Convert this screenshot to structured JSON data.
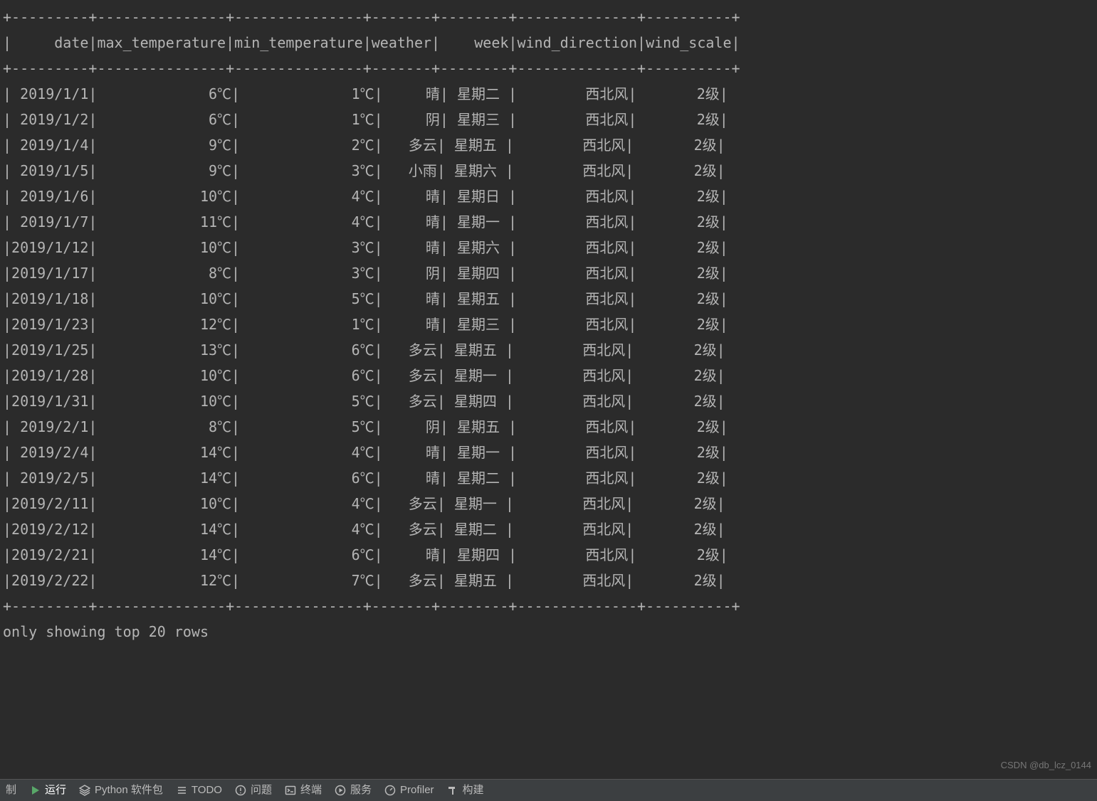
{
  "table": {
    "columns": [
      "date",
      "max_temperature",
      "min_temperature",
      "weather",
      "week",
      "wind_direction",
      "wind_scale"
    ],
    "widths": [
      9,
      15,
      15,
      7,
      8,
      14,
      10
    ],
    "rows": [
      {
        "date": "2019/1/1",
        "max_temperature": "6℃",
        "min_temperature": "1℃",
        "weather": "晴",
        "week": "星期二 ",
        "wind_direction": "西北风",
        "wind_scale": "2级"
      },
      {
        "date": "2019/1/2",
        "max_temperature": "6℃",
        "min_temperature": "1℃",
        "weather": "阴",
        "week": "星期三 ",
        "wind_direction": "西北风",
        "wind_scale": "2级"
      },
      {
        "date": "2019/1/4",
        "max_temperature": "9℃",
        "min_temperature": "2℃",
        "weather": "多云",
        "week": "星期五 ",
        "wind_direction": "西北风",
        "wind_scale": "2级"
      },
      {
        "date": "2019/1/5",
        "max_temperature": "9℃",
        "min_temperature": "3℃",
        "weather": "小雨",
        "week": "星期六 ",
        "wind_direction": "西北风",
        "wind_scale": "2级"
      },
      {
        "date": "2019/1/6",
        "max_temperature": "10℃",
        "min_temperature": "4℃",
        "weather": "晴",
        "week": "星期日 ",
        "wind_direction": "西北风",
        "wind_scale": "2级"
      },
      {
        "date": "2019/1/7",
        "max_temperature": "11℃",
        "min_temperature": "4℃",
        "weather": "晴",
        "week": "星期一 ",
        "wind_direction": "西北风",
        "wind_scale": "2级"
      },
      {
        "date": "2019/1/12",
        "max_temperature": "10℃",
        "min_temperature": "3℃",
        "weather": "晴",
        "week": "星期六 ",
        "wind_direction": "西北风",
        "wind_scale": "2级"
      },
      {
        "date": "2019/1/17",
        "max_temperature": "8℃",
        "min_temperature": "3℃",
        "weather": "阴",
        "week": "星期四 ",
        "wind_direction": "西北风",
        "wind_scale": "2级"
      },
      {
        "date": "2019/1/18",
        "max_temperature": "10℃",
        "min_temperature": "5℃",
        "weather": "晴",
        "week": "星期五 ",
        "wind_direction": "西北风",
        "wind_scale": "2级"
      },
      {
        "date": "2019/1/23",
        "max_temperature": "12℃",
        "min_temperature": "1℃",
        "weather": "晴",
        "week": "星期三 ",
        "wind_direction": "西北风",
        "wind_scale": "2级"
      },
      {
        "date": "2019/1/25",
        "max_temperature": "13℃",
        "min_temperature": "6℃",
        "weather": "多云",
        "week": "星期五 ",
        "wind_direction": "西北风",
        "wind_scale": "2级"
      },
      {
        "date": "2019/1/28",
        "max_temperature": "10℃",
        "min_temperature": "6℃",
        "weather": "多云",
        "week": "星期一 ",
        "wind_direction": "西北风",
        "wind_scale": "2级"
      },
      {
        "date": "2019/1/31",
        "max_temperature": "10℃",
        "min_temperature": "5℃",
        "weather": "多云",
        "week": "星期四 ",
        "wind_direction": "西北风",
        "wind_scale": "2级"
      },
      {
        "date": "2019/2/1",
        "max_temperature": "8℃",
        "min_temperature": "5℃",
        "weather": "阴",
        "week": "星期五 ",
        "wind_direction": "西北风",
        "wind_scale": "2级"
      },
      {
        "date": "2019/2/4",
        "max_temperature": "14℃",
        "min_temperature": "4℃",
        "weather": "晴",
        "week": "星期一 ",
        "wind_direction": "西北风",
        "wind_scale": "2级"
      },
      {
        "date": "2019/2/5",
        "max_temperature": "14℃",
        "min_temperature": "6℃",
        "weather": "晴",
        "week": "星期二 ",
        "wind_direction": "西北风",
        "wind_scale": "2级"
      },
      {
        "date": "2019/2/11",
        "max_temperature": "10℃",
        "min_temperature": "4℃",
        "weather": "多云",
        "week": "星期一 ",
        "wind_direction": "西北风",
        "wind_scale": "2级"
      },
      {
        "date": "2019/2/12",
        "max_temperature": "14℃",
        "min_temperature": "4℃",
        "weather": "多云",
        "week": "星期二 ",
        "wind_direction": "西北风",
        "wind_scale": "2级"
      },
      {
        "date": "2019/2/21",
        "max_temperature": "14℃",
        "min_temperature": "6℃",
        "weather": "晴",
        "week": "星期四 ",
        "wind_direction": "西北风",
        "wind_scale": "2级"
      },
      {
        "date": "2019/2/22",
        "max_temperature": "12℃",
        "min_temperature": "7℃",
        "weather": "多云",
        "week": "星期五 ",
        "wind_direction": "西北风",
        "wind_scale": "2级"
      }
    ],
    "footer": "only showing top 20 rows"
  },
  "bottom_bar": {
    "items": [
      {
        "label": "制",
        "icon": "none"
      },
      {
        "label": "运行",
        "icon": "play",
        "active": true
      },
      {
        "label": "Python 软件包",
        "icon": "stack"
      },
      {
        "label": "TODO",
        "icon": "list"
      },
      {
        "label": "问题",
        "icon": "alert"
      },
      {
        "label": "终端",
        "icon": "terminal"
      },
      {
        "label": "服务",
        "icon": "play-circle"
      },
      {
        "label": "Profiler",
        "icon": "gauge"
      },
      {
        "label": "构建",
        "icon": "hammer"
      }
    ]
  },
  "watermark": "CSDN @db_lcz_0144"
}
